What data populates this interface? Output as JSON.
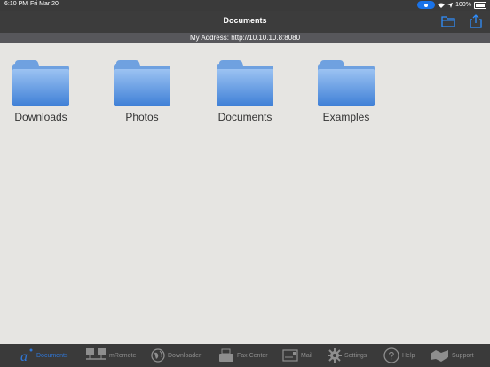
{
  "status_bar": {
    "time": "6:10 PM",
    "date": "Fri Mar 20",
    "battery": "100%",
    "icons": [
      "bluetooth-icon",
      "wifi-icon",
      "location-icon",
      "battery-icon"
    ]
  },
  "nav": {
    "title": "Documents",
    "buttons": [
      "new-folder-icon",
      "share-icon"
    ]
  },
  "address": "My Address: http://10.10.10.8:8080",
  "folders": [
    {
      "label": "Downloads"
    },
    {
      "label": "Photos"
    },
    {
      "label": "Documents"
    },
    {
      "label": "Examples"
    }
  ],
  "tabs": [
    {
      "label": "Documents",
      "icon": "documents-icon",
      "active": true
    },
    {
      "label": "mRemote",
      "icon": "network-icon",
      "active": false
    },
    {
      "label": "Downloader",
      "icon": "globe-icon",
      "active": false
    },
    {
      "label": "Fax Center",
      "icon": "fax-icon",
      "active": false
    },
    {
      "label": "Mail",
      "icon": "mail-icon",
      "active": false
    },
    {
      "label": "Settings",
      "icon": "gear-icon",
      "active": false
    },
    {
      "label": "Help",
      "icon": "help-icon",
      "active": false
    },
    {
      "label": "Support",
      "icon": "support-icon",
      "active": false
    }
  ],
  "colors": {
    "accent": "#2f77d8",
    "folder_top": "#9cc3f2",
    "folder_bottom": "#3e7fd6",
    "bar_bg": "#3a3a3a"
  }
}
